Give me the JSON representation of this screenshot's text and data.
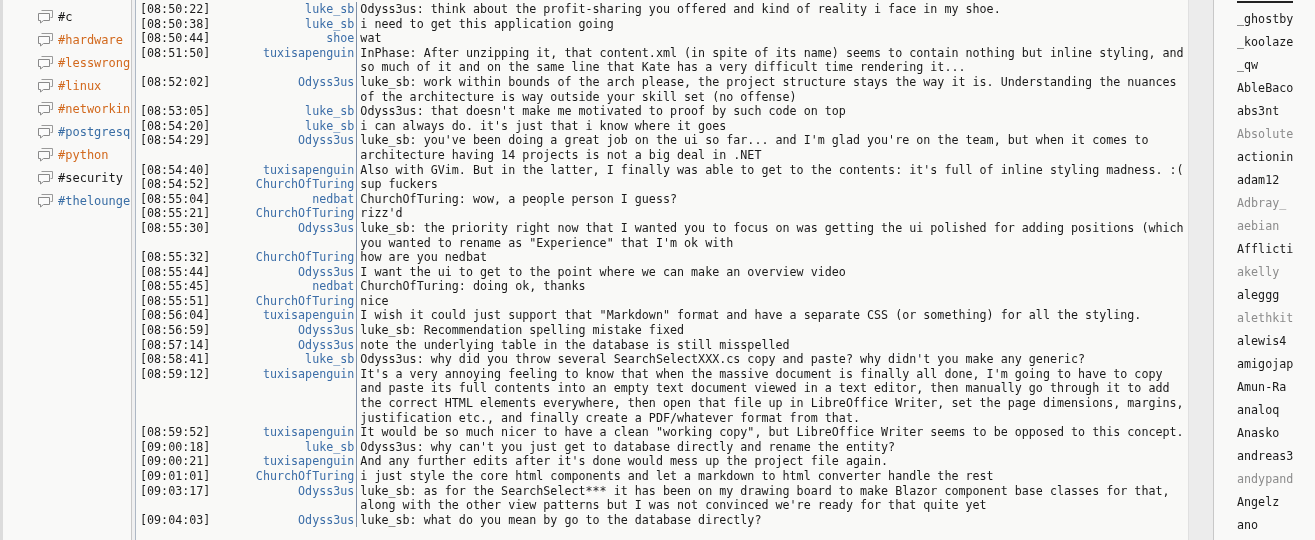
{
  "channels": [
    {
      "name": "#c",
      "color": "#1a1a1a"
    },
    {
      "name": "#hardware",
      "color": "#d2691e"
    },
    {
      "name": "#lesswrong",
      "color": "#d2691e"
    },
    {
      "name": "#linux",
      "color": "#d2691e"
    },
    {
      "name": "#networkin",
      "color": "#d2691e"
    },
    {
      "name": "#postgresq",
      "color": "#3a6ea5"
    },
    {
      "name": "#python",
      "color": "#d2691e"
    },
    {
      "name": "#security",
      "color": "#1a1a1a"
    },
    {
      "name": "#thelounge",
      "color": "#3a6ea5"
    }
  ],
  "messages": [
    {
      "time": "[08:50:22]",
      "nick": "luke_sb",
      "text": "Odyss3us: think about the profit-sharing you offered and kind of reality i face in my shoe."
    },
    {
      "time": "[08:50:38]",
      "nick": "luke_sb",
      "text": "i need to get this application going"
    },
    {
      "time": "[08:50:44]",
      "nick": "shoe",
      "text": "wat"
    },
    {
      "time": "[08:51:50]",
      "nick": "tuxisapenguin",
      "text": "InPhase: After unzipping it, that content.xml (in spite of its name) seems to contain nothing but inline styling, and so much of it and on the same line that Kate has a very difficult time rendering it..."
    },
    {
      "time": "[08:52:02]",
      "nick": "Odyss3us",
      "text": "luke_sb: work within bounds of the arch please, the project structure stays the way it is. Understanding the nuances of the architecture is way outside your skill set (no offense)"
    },
    {
      "time": "[08:53:05]",
      "nick": "luke_sb",
      "text": "Odyss3us: that doesn't make me motivated to proof by such code on top"
    },
    {
      "time": "[08:54:20]",
      "nick": "luke_sb",
      "text": "i can always do. it's just that i know where it goes"
    },
    {
      "time": "[08:54:29]",
      "nick": "Odyss3us",
      "text": "luke_sb: you've been doing a great job on the ui so far... and I'm glad you're on the team, but when it comes to architecture having 14 projects is not a big deal in .NET"
    },
    {
      "time": "[08:54:40]",
      "nick": "tuxisapenguin",
      "text": "Also with GVim. But in the latter, I finally was able to get to the contents: it's full of inline styling madness. :("
    },
    {
      "time": "[08:54:52]",
      "nick": "ChurchOfTuring",
      "text": "sup fuckers"
    },
    {
      "time": "[08:55:04]",
      "nick": "nedbat",
      "text": "ChurchOfTuring: wow, a people person I guess?"
    },
    {
      "time": "[08:55:21]",
      "nick": "ChurchOfTuring",
      "text": "rizz'd"
    },
    {
      "time": "[08:55:30]",
      "nick": "Odyss3us",
      "text": "luke_sb: the priority right now that I wanted you to focus on was getting the ui polished for adding positions (which you wanted to rename as \"Experience\" that I'm ok with"
    },
    {
      "time": "[08:55:32]",
      "nick": "ChurchOfTuring",
      "text": "how are you nedbat"
    },
    {
      "time": "[08:55:44]",
      "nick": "Odyss3us",
      "text": "I want the ui to get to the point where we can make an overview video"
    },
    {
      "time": "[08:55:45]",
      "nick": "nedbat",
      "text": "ChurchOfTuring: doing ok, thanks"
    },
    {
      "time": "[08:55:51]",
      "nick": "ChurchOfTuring",
      "text": "nice"
    },
    {
      "time": "[08:56:04]",
      "nick": "tuxisapenguin",
      "text": "I wish it could just support that \"Markdown\" format and have a separate CSS (or something) for all the styling."
    },
    {
      "time": "[08:56:59]",
      "nick": "Odyss3us",
      "text": "luke_sb: Recommendation spelling mistake fixed"
    },
    {
      "time": "[08:57:14]",
      "nick": "Odyss3us",
      "text": "note the underlying table in the database is still misspelled"
    },
    {
      "time": "[08:58:41]",
      "nick": "luke_sb",
      "text": "Odyss3us: why did you throw several SearchSelectXXX.cs copy and paste? why didn't you make any generic?"
    },
    {
      "time": "[08:59:12]",
      "nick": "tuxisapenguin",
      "text": "It's a very annoying feeling to know that when the massive document is finally all done, I'm going to have to copy and paste its full contents into an empty text document viewed in a text editor, then manually go through it to add the correct HTML elements everywhere, then open that file up in LibreOffice Writer, set the page dimensions, margins, justification etc., and finally create a PDF/whatever format from that."
    },
    {
      "time": "[08:59:52]",
      "nick": "tuxisapenguin",
      "text": "It would be so much nicer to have a clean \"working copy\", but LibreOffice Writer seems to be opposed to this concept."
    },
    {
      "time": "[09:00:18]",
      "nick": "luke_sb",
      "text": "Odyss3us: why can't you just get to database directly and rename the entity?"
    },
    {
      "time": "[09:00:21]",
      "nick": "tuxisapenguin",
      "text": "And any further edits after it's done would mess up the project file again."
    },
    {
      "time": "[09:01:01]",
      "nick": "ChurchOfTuring",
      "text": "i just style the core html components and let a markdown to html converter handle the rest"
    },
    {
      "time": "[09:03:17]",
      "nick": "Odyss3us",
      "text": "luke_sb: as for the SearchSelect*** it has been on my drawing board to make Blazor component base classes for that, along with the other view patterns but I was not convinced we're ready for that quite yet"
    },
    {
      "time": "[09:04:03]",
      "nick": "Odyss3us",
      "text": "luke_sb: what do you mean by go to the database directly?"
    }
  ],
  "users": [
    {
      "name": "_ghostby",
      "away": false
    },
    {
      "name": "_koolaze",
      "away": false
    },
    {
      "name": "_qw",
      "away": false
    },
    {
      "name": "AbleBaco",
      "away": false
    },
    {
      "name": "abs3nt",
      "away": false
    },
    {
      "name": "Absolute",
      "away": true
    },
    {
      "name": "actionin",
      "away": false
    },
    {
      "name": "adam12",
      "away": false
    },
    {
      "name": "Adbray_",
      "away": true
    },
    {
      "name": "aebian",
      "away": true
    },
    {
      "name": "Afflicti",
      "away": false
    },
    {
      "name": "akelly",
      "away": true
    },
    {
      "name": "aleggg",
      "away": false
    },
    {
      "name": "alethkit",
      "away": true
    },
    {
      "name": "alewis4",
      "away": false
    },
    {
      "name": "amigojap",
      "away": false
    },
    {
      "name": "Amun-Ra",
      "away": false
    },
    {
      "name": "analoq",
      "away": false
    },
    {
      "name": "Anasko",
      "away": false
    },
    {
      "name": "andreas3",
      "away": false
    },
    {
      "name": "andypand",
      "away": true
    },
    {
      "name": "Angelz",
      "away": false
    },
    {
      "name": "ano",
      "away": false
    }
  ]
}
